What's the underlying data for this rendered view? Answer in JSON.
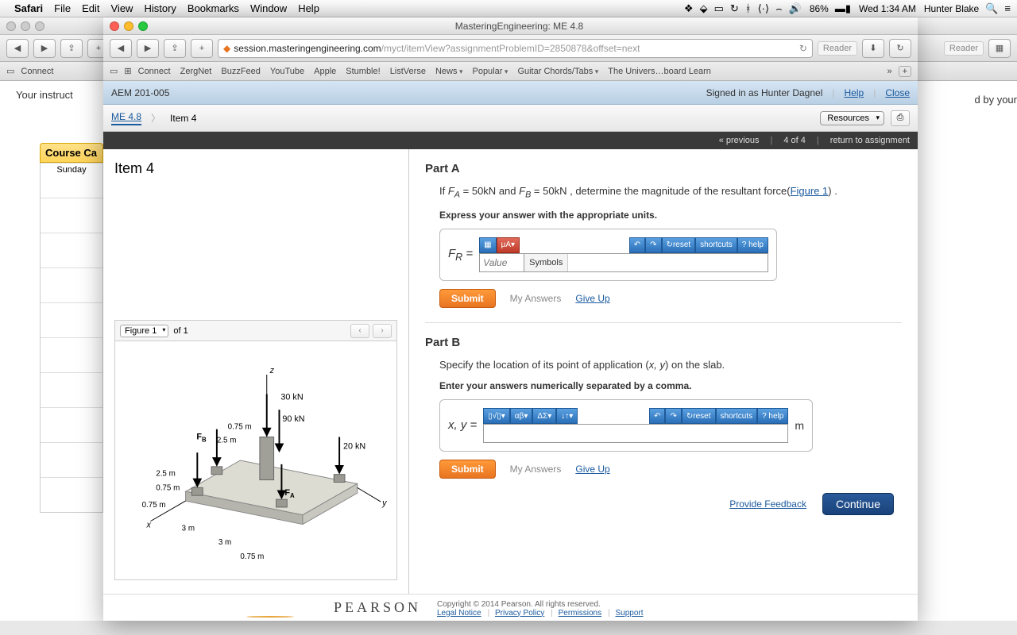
{
  "menubar": {
    "app": "Safari",
    "items": [
      "File",
      "Edit",
      "View",
      "History",
      "Bookmarks",
      "Window",
      "Help"
    ],
    "battery": "86%",
    "clock": "Wed 1:34 AM",
    "user": "Hunter Blake"
  },
  "bgwin": {
    "instr_left": "Your instruct",
    "instr_right": "d by your",
    "course_cal": "Course Ca",
    "sunday": "Sunday"
  },
  "fgwin": {
    "title": "MasteringEngineering: ME 4.8",
    "url_host": "session.masteringengineering.com",
    "url_path": "/myct/itemView?assignmentProblemID=2850878&offset=next",
    "reader": "Reader",
    "fav": [
      "Connect",
      "ZergNet",
      "BuzzFeed",
      "YouTube",
      "Apple",
      "Stumble!",
      "ListVerse",
      "News",
      "Popular",
      "Guitar Chords/Tabs",
      "The Univers…board Learn"
    ],
    "fav_dd": [
      7,
      8,
      9
    ]
  },
  "mast": {
    "course": "AEM 201-005",
    "signed": "Signed in as Hunter Dagnel",
    "help": "Help",
    "close": "Close",
    "crumb1": "ME 4.8",
    "crumb2": "Item 4",
    "resources": "Resources",
    "nav_prev": "« previous",
    "nav_pos": "4 of 4",
    "nav_return": "return to assignment"
  },
  "left": {
    "item": "Item 4",
    "figsel": "Figure 1",
    "of": "of 1",
    "fig": {
      "z": "z",
      "x": "x",
      "y": "y",
      "f30": "30 kN",
      "f90": "90 kN",
      "f20": "20 kN",
      "fa": "F",
      "fa_sub": "A",
      "fb": "F",
      "fb_sub": "B",
      "d075": "0.75 m",
      "d25": "2.5 m",
      "d3": "3 m"
    }
  },
  "partA": {
    "title": "Part A",
    "text_pre": "If ",
    "fa": "F",
    "fa_sub": "A",
    "eq1": " = 50kN ",
    "and": "and ",
    "fb": "F",
    "fb_sub": "B",
    "eq2": " = 50kN ",
    "text_post": ", determine the magnitude of the resultant force(",
    "figlink": "Figure 1",
    "text_end": ") .",
    "instr": "Express your answer with the appropriate units.",
    "lhs": "F",
    "lhs_sub": "R",
    "eq": " = ",
    "value_ph": "Value",
    "symbols": "Symbols",
    "reset": "reset",
    "shortcuts": "shortcuts",
    "helpb": "? help",
    "submit": "Submit",
    "myans": "My Answers",
    "giveup": "Give Up"
  },
  "partB": {
    "title": "Part B",
    "text": "Specify the location of its point of application (",
    "xy": "x, y",
    "text2": ") on the slab.",
    "instr": "Enter your answers numerically separated by a comma.",
    "lhs": "x, y",
    "eq": " = ",
    "unit": "m",
    "reset": "reset",
    "shortcuts": "shortcuts",
    "helpb": "? help",
    "submit": "Submit",
    "myans": "My Answers",
    "giveup": "Give Up"
  },
  "bottom": {
    "feedback": "Provide Feedback",
    "continue": "Continue"
  },
  "footer": {
    "pearson": "PEARSON",
    "copy": "Copyright © 2014 Pearson. All rights reserved.",
    "legal": "Legal Notice",
    "privacy": "Privacy Policy",
    "perm": "Permissions",
    "support": "Support"
  }
}
